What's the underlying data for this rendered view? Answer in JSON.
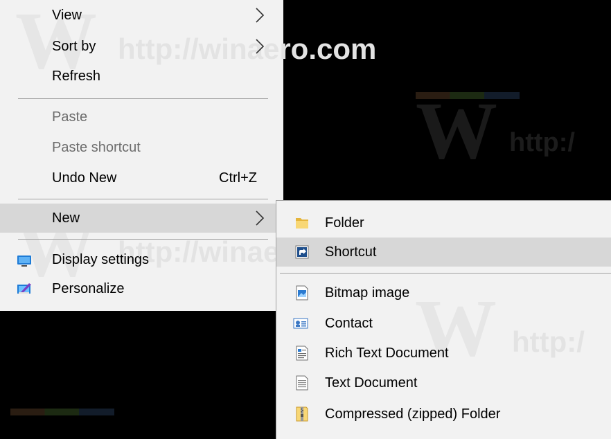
{
  "watermark": {
    "text": "http://winaero.com",
    "letter": "W",
    "short": "http:/"
  },
  "context_menu": {
    "items": [
      {
        "label": "View"
      },
      {
        "label": "Sort by"
      },
      {
        "label": "Refresh"
      },
      {
        "label": "Paste"
      },
      {
        "label": "Paste shortcut"
      },
      {
        "label": "Undo New",
        "shortcut": "Ctrl+Z"
      },
      {
        "label": "New"
      },
      {
        "label": "Display settings"
      },
      {
        "label": "Personalize"
      }
    ]
  },
  "new_submenu": {
    "items": [
      {
        "label": "Folder",
        "icon": "folder-icon"
      },
      {
        "label": "Shortcut",
        "icon": "shortcut-icon"
      },
      {
        "label": "Bitmap image",
        "icon": "bitmap-image-icon"
      },
      {
        "label": "Contact",
        "icon": "contact-card-icon"
      },
      {
        "label": "Rich Text Document",
        "icon": "rich-text-document-icon"
      },
      {
        "label": "Text Document",
        "icon": "text-document-icon"
      },
      {
        "label": "Compressed (zipped) Folder",
        "icon": "zip-folder-icon"
      }
    ]
  },
  "colors": {
    "menu_background": "#f2f2f2",
    "hover_background": "#d7d7d7",
    "disabled_text": "#6d6d6d",
    "separator": "#a0a0a0",
    "desktop": "#000000",
    "folder_yellow": "#f8d775"
  }
}
